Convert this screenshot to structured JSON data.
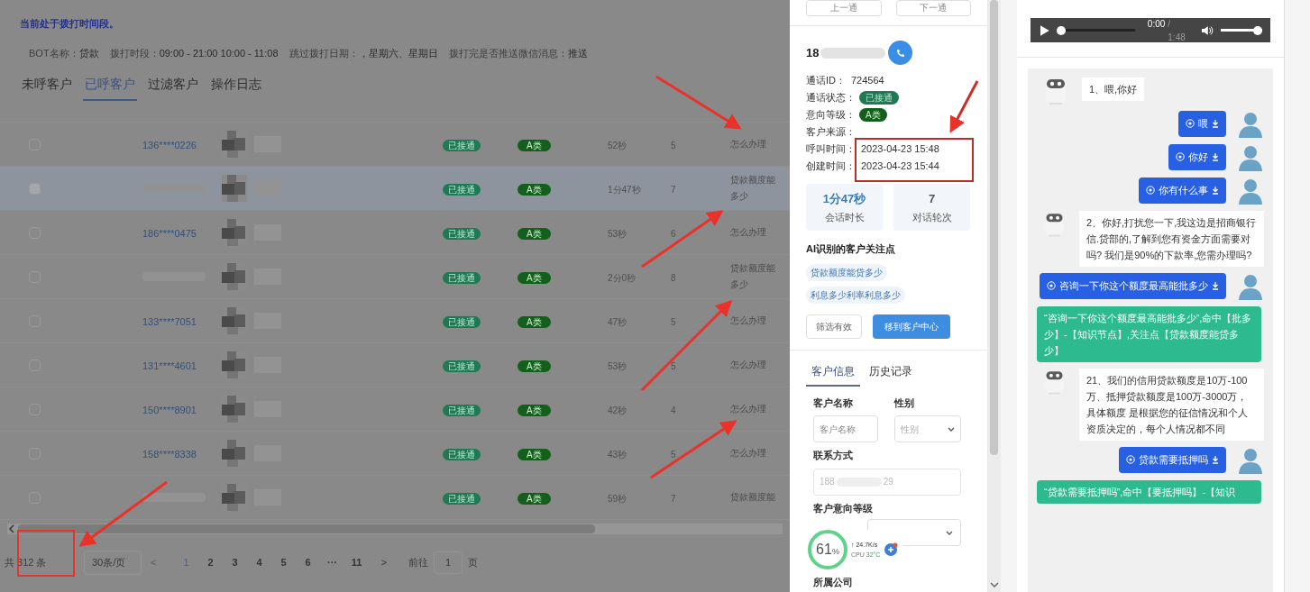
{
  "header": {
    "notice": "当前处于拨打时间段。",
    "info": [
      {
        "label": "BOT名称：",
        "value": "贷款"
      },
      {
        "label": "拨打时段：",
        "value": "09:00 - 21:00 10:00 - 11:08"
      },
      {
        "label": "跳过拨打日期：",
        "value": "，星期六、星期日"
      },
      {
        "label": "拨打完是否推送微信消息：",
        "value": "推送"
      }
    ]
  },
  "tabs": [
    {
      "label": "未呼客户",
      "selected": false
    },
    {
      "label": "已呼客户",
      "selected": true
    },
    {
      "label": "过滤客户",
      "selected": false
    },
    {
      "label": "操作日志",
      "selected": false
    }
  ],
  "table": {
    "rows": [
      {
        "phone": "136****0226",
        "status": "已接通",
        "level": "A类",
        "duration": "52秒",
        "rounds": "5",
        "focus": [
          "怎么办理"
        ],
        "selected": false
      },
      {
        "status": "已接通",
        "level": "A类",
        "duration": "1分47秒",
        "rounds": "7",
        "focus": [
          "贷款额度能",
          "多少"
        ],
        "selected": true
      },
      {
        "phone": "186****0475",
        "status": "已接通",
        "level": "A类",
        "duration": "53秒",
        "rounds": "6",
        "focus": [
          "怎么办理"
        ],
        "selected": false
      },
      {
        "status": "已接通",
        "level": "A类",
        "duration": "2分0秒",
        "rounds": "8",
        "focus": [
          "贷款额度能",
          "多少"
        ],
        "selected": false
      },
      {
        "phone": "133****7051",
        "status": "已接通",
        "level": "A类",
        "duration": "47秒",
        "rounds": "5",
        "focus": [
          "怎么办理"
        ],
        "selected": false
      },
      {
        "phone": "131****4601",
        "status": "已接通",
        "level": "A类",
        "duration": "53秒",
        "rounds": "5",
        "focus": [
          "怎么办理"
        ],
        "selected": false
      },
      {
        "phone": "150****8901",
        "status": "已接通",
        "level": "A类",
        "duration": "42秒",
        "rounds": "4",
        "focus": [
          "怎么办理"
        ],
        "selected": false
      },
      {
        "phone": "158****8338",
        "status": "已接通",
        "level": "A类",
        "duration": "43秒",
        "rounds": "5",
        "focus": [
          "怎么办理"
        ],
        "selected": false
      },
      {
        "status": "已接通",
        "level": "A类",
        "duration": "59秒",
        "rounds": "7",
        "focus": [
          "贷款额度能"
        ],
        "selected": false
      }
    ]
  },
  "pagination": {
    "total": "共 312 条",
    "page_size": "30条/页",
    "prev": "<",
    "pages": [
      {
        "label": "1",
        "selected": true
      },
      {
        "label": "2",
        "selected": false
      },
      {
        "label": "3",
        "selected": false
      },
      {
        "label": "4",
        "selected": false
      },
      {
        "label": "5",
        "selected": false
      },
      {
        "label": "6",
        "selected": false
      },
      {
        "label": "···",
        "selected": false
      },
      {
        "label": "11",
        "selected": false
      }
    ],
    "next": ">",
    "goto_label": "前往",
    "goto_value": "1",
    "goto_unit": "页"
  },
  "detail": {
    "nav_buttons": [
      "上一通",
      "下一通"
    ],
    "phone_prefix": "18",
    "fields": [
      {
        "label": "通话ID：",
        "value": "724564",
        "kind": "text"
      },
      {
        "label": "通话状态：",
        "value": "已接通",
        "kind": "status"
      },
      {
        "label": "意向等级：",
        "value": "A类",
        "kind": "level"
      },
      {
        "label": "客户来源：",
        "kind": "text"
      },
      {
        "label": "呼叫时间：",
        "value": "2023-04-23 15:48",
        "kind": "text"
      },
      {
        "label": "创建时间：",
        "value": "2023-04-23 15:44",
        "kind": "text"
      }
    ],
    "stats": [
      {
        "value": "1分47秒",
        "label": "会话时长",
        "kind": "accent"
      },
      {
        "value": "7",
        "label": "对话轮次",
        "kind": "plain"
      }
    ],
    "focus_title": "AI识别的客户关注点",
    "focus_tags": [
      "贷款额度能贷多少",
      "利息多少利率利息多少"
    ],
    "actions": [
      {
        "label": "筛选有效",
        "kind": "outline"
      },
      {
        "label": "移到客户中心",
        "kind": "primary"
      }
    ],
    "tabs": [
      {
        "label": "客户信息",
        "selected": true
      },
      {
        "label": "历史记录",
        "selected": false
      }
    ],
    "form": {
      "name_label": "客户名称",
      "name_placeholder": "客户名称",
      "gender_label": "性别",
      "gender_placeholder": "性别",
      "contact_label": "联系方式",
      "contact_start": "188",
      "contact_end": "29",
      "intent_label": "客户意向等级",
      "company_label": "所属公司"
    }
  },
  "monitor": {
    "percent": "61",
    "unit": "%",
    "speed": "↑ 24.7K/s",
    "cpu_label": "CPU",
    "cpu_temp": "32°C"
  },
  "recording": {
    "time": "0:00",
    "total": "/ 1:48",
    "progress": {
      "level": 0.0
    },
    "volume": {
      "level": 1.0
    }
  },
  "chat": [
    {
      "kind": "bot",
      "text": "1、喂,你好"
    },
    {
      "kind": "user",
      "text": "喂"
    },
    {
      "kind": "user",
      "text": "你好"
    },
    {
      "kind": "user",
      "text": "你有什么事"
    },
    {
      "kind": "bot",
      "text": "2、你好,打扰您一下,我这边是招商银行信.贷部的,了解到您有资金方面需要对吗? 我们是90%的下款率,您需办理吗?"
    },
    {
      "kind": "user",
      "text": "咨询一下你这个额度最高能批多少"
    },
    {
      "kind": "hit",
      "text": "“咨询一下你这个额度最高能批多少”,命中【批多少】-【知识节点】,关注点【贷款额度能贷多少】"
    },
    {
      "kind": "bot",
      "text": "21、我们的信用贷款额度是10万-100万、抵押贷款额度是100万-3000万，具体额度 是根据您的征信情况和个人资质决定的，每个人情况都不同"
    },
    {
      "kind": "user",
      "text": "贷款需要抵押吗"
    },
    {
      "kind": "hit",
      "text": "“贷款需要抵押吗”,命中【要抵押吗】-【知识"
    }
  ]
}
